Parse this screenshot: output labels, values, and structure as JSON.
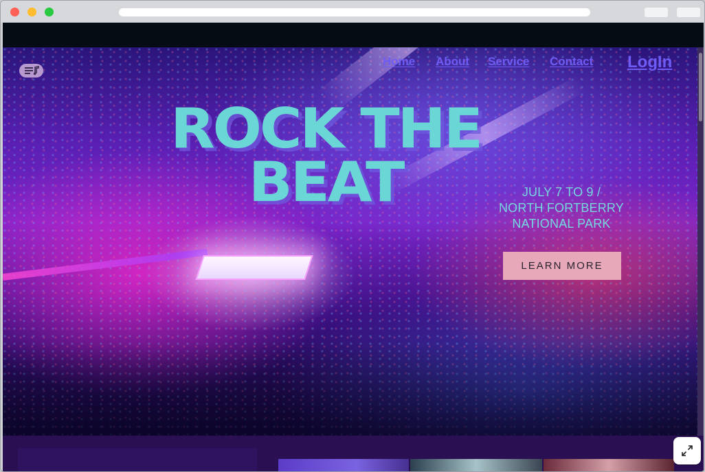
{
  "nav": {
    "home": "Home",
    "about": "About",
    "service": "Service",
    "contact": "Contact",
    "login": "LogIn"
  },
  "hero": {
    "headline_line1": "ROCK THE",
    "headline_line2": "BEAT",
    "dates": "JULY 7 TO 9 /",
    "venue_line1": "NORTH FORTBERRY",
    "venue_line2": "NATIONAL PARK",
    "cta_label": "LEARN MORE"
  },
  "colors": {
    "headline": "#6bd6d6",
    "nav_link": "#6f5cf4",
    "cta_background": "#e7a8b9",
    "lower_section": "#2a0f52"
  },
  "icons": {
    "menu": "music-menu-icon",
    "expand": "expand-icon"
  }
}
